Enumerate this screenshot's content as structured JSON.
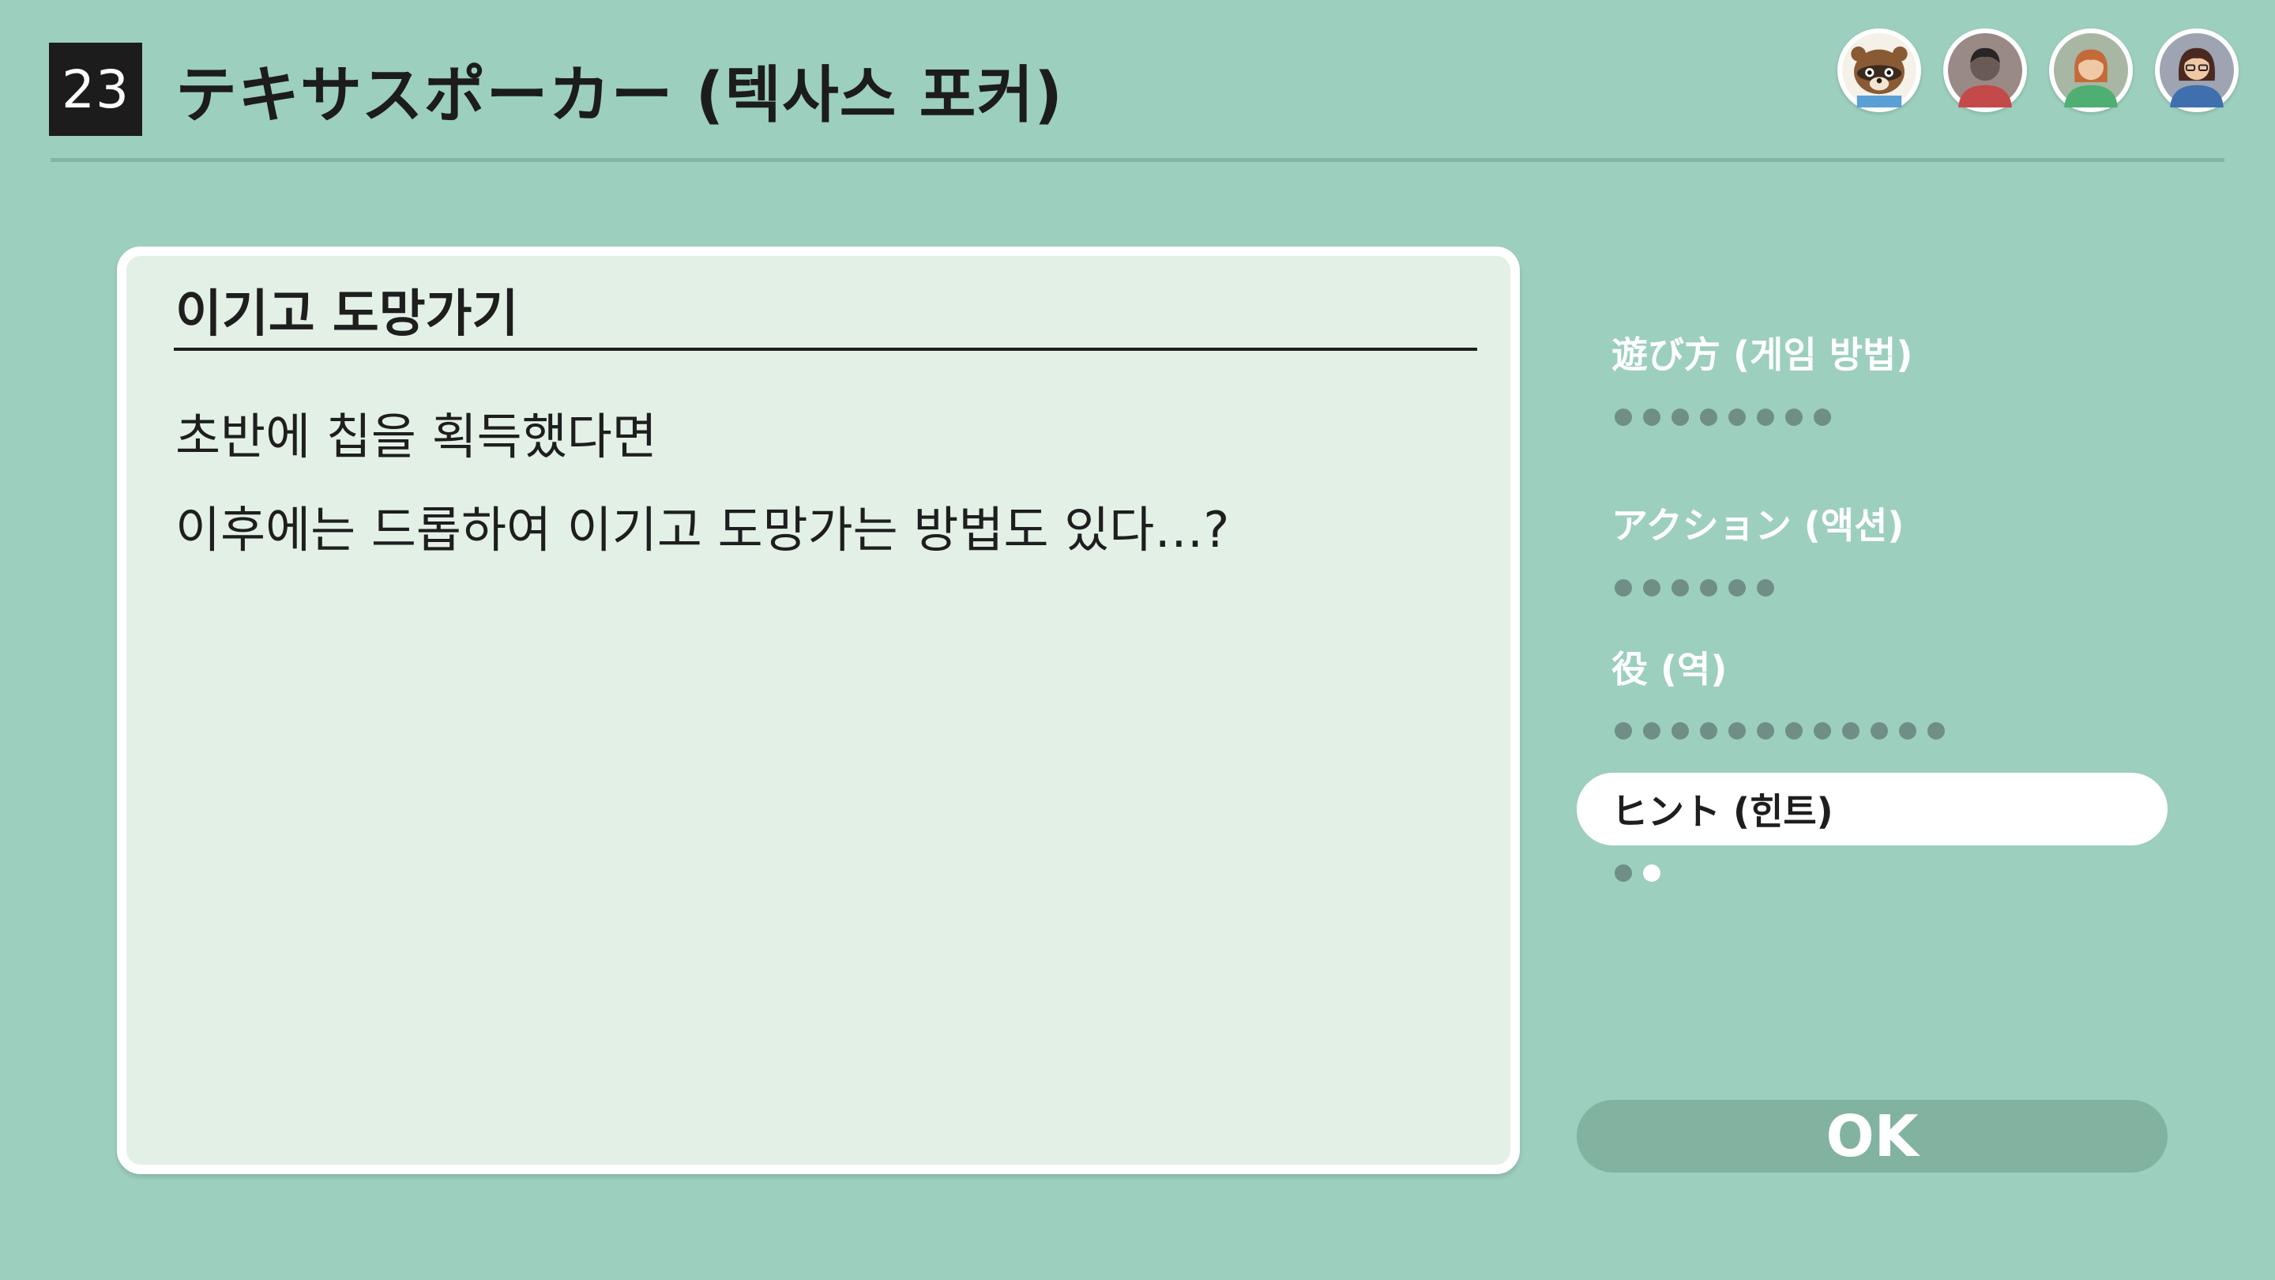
{
  "header": {
    "game_number": "23",
    "title": "テキサスポーカー (텍사스 포커)"
  },
  "players": [
    {
      "icon": "raccoon-avatar-icon"
    },
    {
      "icon": "player-avatar-icon"
    },
    {
      "icon": "player-avatar-icon"
    },
    {
      "icon": "player-avatar-icon"
    }
  ],
  "panel": {
    "title": "이기고 도망가기",
    "lines": [
      "초반에 칩을 획득했다면",
      "이후에는 드롭하여 이기고 도망가는 방법도 있다…?"
    ]
  },
  "menu": {
    "items": [
      {
        "label": "遊び方 (게임 방법)",
        "pages": 8,
        "current_page": 0,
        "selected": false
      },
      {
        "label": "アクション (액션)",
        "pages": 6,
        "current_page": 0,
        "selected": false
      },
      {
        "label": "役 (역)",
        "pages": 12,
        "current_page": 0,
        "selected": false
      },
      {
        "label": "ヒント (힌트)",
        "pages": 2,
        "current_page": 2,
        "selected": true
      }
    ]
  },
  "ok_button": {
    "label": "OK"
  },
  "colors": {
    "background": "#9ccfbd",
    "panel": "#e3f0e6",
    "ink": "#1e1e1e",
    "dot_inactive": "#6f8f86",
    "dot_active": "#ffffff",
    "ok_button": "#82b2a0"
  }
}
